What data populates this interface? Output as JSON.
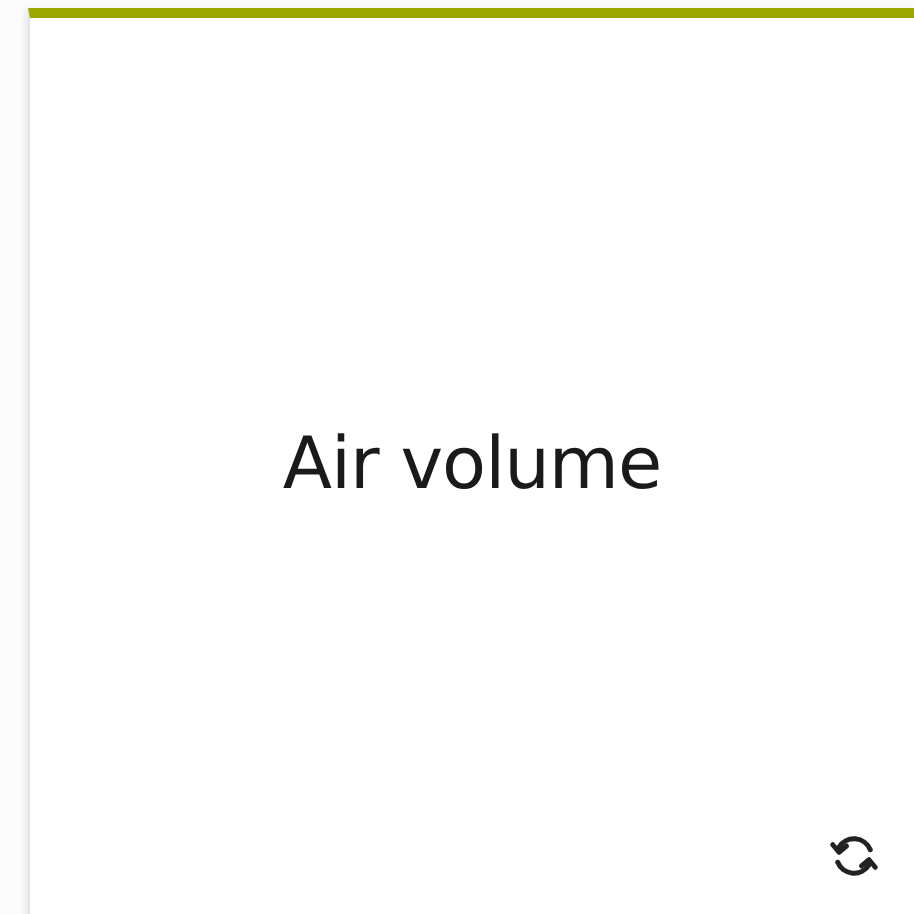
{
  "card": {
    "title": "Air volume"
  }
}
